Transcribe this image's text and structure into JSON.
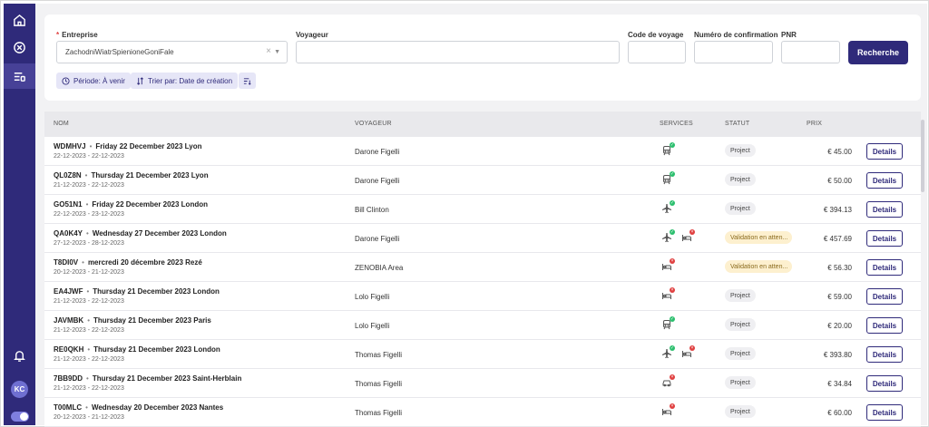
{
  "filters": {
    "entreprise": {
      "label": "Entreprise",
      "value": "ZachodniWiatrSpienioneGoniFale"
    },
    "voyageur": {
      "label": "Voyageur",
      "value": ""
    },
    "code_voyage": {
      "label": "Code de voyage",
      "value": ""
    },
    "confirmation": {
      "label": "Numéro de confirmation",
      "value": ""
    },
    "pnr": {
      "label": "PNR",
      "value": ""
    },
    "search_label": "Recherche",
    "chip_period": "Période: À venir",
    "chip_sort": "Trier par: Date de création"
  },
  "table": {
    "headers": {
      "nom": "NOM",
      "voyageur": "VOYAGEUR",
      "services": "SERVICES",
      "statut": "STATUT",
      "prix": "PRIX"
    },
    "details_label": "Details",
    "rows": [
      {
        "code": "WDMHVJ",
        "title": "Friday 22 December 2023 Lyon",
        "dates": "22-12-2023 - 22-12-2023",
        "traveler": "Darone Figelli",
        "services": [
          {
            "icon": "train-icon",
            "state": "ok"
          }
        ],
        "status": "Project",
        "status_type": "project",
        "price": "€ 45.00"
      },
      {
        "code": "QL0Z8N",
        "title": "Thursday 21 December 2023 Lyon",
        "dates": "21-12-2023 - 22-12-2023",
        "traveler": "Darone Figelli",
        "services": [
          {
            "icon": "train-icon",
            "state": "ok"
          }
        ],
        "status": "Project",
        "status_type": "project",
        "price": "€ 50.00"
      },
      {
        "code": "GO51N1",
        "title": "Friday 22 December 2023 London",
        "dates": "22-12-2023 - 23-12-2023",
        "traveler": "Bill Clinton",
        "services": [
          {
            "icon": "plane-icon",
            "state": "ok"
          }
        ],
        "status": "Project",
        "status_type": "project",
        "price": "€ 394.13"
      },
      {
        "code": "QA0K4Y",
        "title": "Wednesday 27 December 2023 London",
        "dates": "27-12-2023 - 28-12-2023",
        "traveler": "Darone Figelli",
        "services": [
          {
            "icon": "plane-icon",
            "state": "ok"
          },
          {
            "icon": "hotel-icon",
            "state": "ko"
          }
        ],
        "status": "Validation en atten...",
        "status_type": "pending",
        "price": "€ 457.69"
      },
      {
        "code": "T8DI0V",
        "title": "mercredi 20 décembre 2023 Rezé",
        "dates": "20-12-2023 - 21-12-2023",
        "traveler": "ZENOBIA Area",
        "services": [
          {
            "icon": "hotel-icon",
            "state": "ko"
          }
        ],
        "status": "Validation en atten...",
        "status_type": "pending",
        "price": "€ 56.30"
      },
      {
        "code": "EA4JWF",
        "title": "Thursday 21 December 2023 London",
        "dates": "21-12-2023 - 22-12-2023",
        "traveler": "Lolo Figelli",
        "services": [
          {
            "icon": "hotel-icon",
            "state": "ko"
          }
        ],
        "status": "Project",
        "status_type": "project",
        "price": "€ 59.00"
      },
      {
        "code": "JAVMBK",
        "title": "Thursday 21 December 2023 Paris",
        "dates": "21-12-2023 - 22-12-2023",
        "traveler": "Lolo Figelli",
        "services": [
          {
            "icon": "train-icon",
            "state": "ok"
          }
        ],
        "status": "Project",
        "status_type": "project",
        "price": "€ 20.00"
      },
      {
        "code": "RE0QKH",
        "title": "Thursday 21 December 2023 London",
        "dates": "21-12-2023 - 22-12-2023",
        "traveler": "Thomas Figelli",
        "services": [
          {
            "icon": "plane-icon",
            "state": "ok"
          },
          {
            "icon": "hotel-icon",
            "state": "ko"
          }
        ],
        "status": "Project",
        "status_type": "project",
        "price": "€ 393.80"
      },
      {
        "code": "7BB9DD",
        "title": "Thursday 21 December 2023 Saint-Herblain",
        "dates": "21-12-2023 - 22-12-2023",
        "traveler": "Thomas Figelli",
        "services": [
          {
            "icon": "car-icon",
            "state": "ko"
          }
        ],
        "status": "Project",
        "status_type": "project",
        "price": "€ 34.84"
      },
      {
        "code": "T00MLC",
        "title": "Wednesday 20 December 2023 Nantes",
        "dates": "20-12-2023 - 21-12-2023",
        "traveler": "Thomas Figelli",
        "services": [
          {
            "icon": "hotel-icon",
            "state": "ko"
          }
        ],
        "status": "Project",
        "status_type": "project",
        "price": "€ 60.00"
      }
    ]
  },
  "sidebar": {
    "avatar_initials": "KC"
  },
  "colors": {
    "brand": "#2f2a7a",
    "ok": "#2cbf6e",
    "ko": "#e04040",
    "pending_bg": "#fdf0cf"
  }
}
